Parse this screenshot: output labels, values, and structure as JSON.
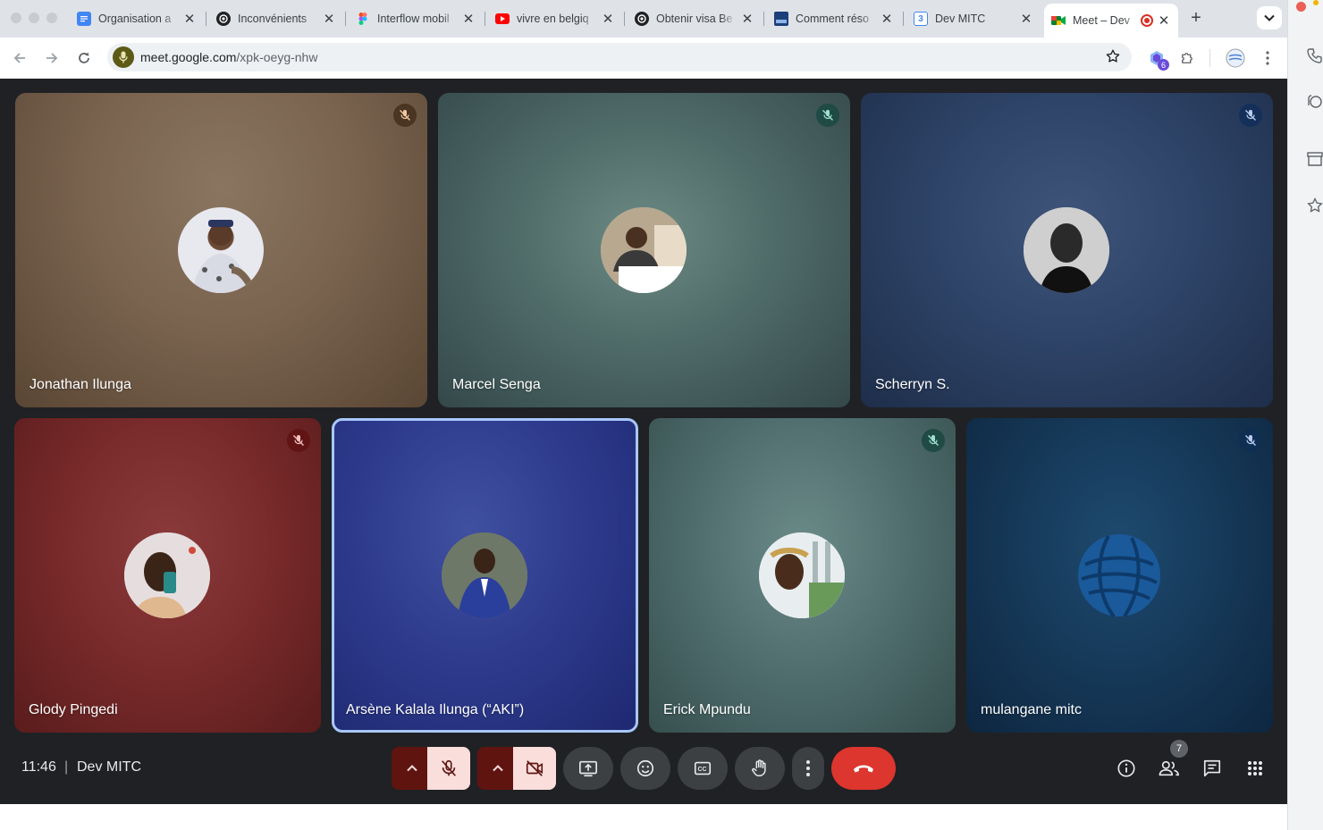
{
  "browser": {
    "tabs": [
      {
        "title": "Organisation a",
        "favicon": "google-docs-icon"
      },
      {
        "title": "Inconvénients",
        "favicon": "openai-icon"
      },
      {
        "title": "Interflow mobil",
        "favicon": "figma-icon"
      },
      {
        "title": "vivre en belgiq",
        "favicon": "youtube-icon"
      },
      {
        "title": "Obtenir visa Be",
        "favicon": "openai-icon"
      },
      {
        "title": "Comment réso",
        "favicon": "site-icon"
      },
      {
        "title": "Dev MITC",
        "favicon": "google-calendar-icon"
      },
      {
        "title": "Meet – Dev",
        "favicon": "google-meet-icon"
      }
    ],
    "calendar_favicon_text": "3",
    "url_host": "meet.google.com",
    "url_path": "/xpk-oeyg-nhw",
    "extension_badge": "6"
  },
  "meeting": {
    "time": "11:46",
    "separator": "|",
    "name": "Dev MITC",
    "participant_count": "7"
  },
  "participants": [
    {
      "name": "Jonathan Ilunga",
      "muted": true,
      "color": "#7a6450"
    },
    {
      "name": "Marcel Senga",
      "muted": true,
      "color": "#4f6b68"
    },
    {
      "name": "Scherryn S.",
      "muted": true,
      "color": "#2e4468"
    },
    {
      "name": "Glody Pingedi",
      "muted": true,
      "color": "#7a2b2b"
    },
    {
      "name": "Arsène Kalala Ilunga (“AKI”)",
      "muted": false,
      "speaking": true,
      "color": "#2d3a8c"
    },
    {
      "name": "Erick Mpundu",
      "muted": true,
      "color": "#527070"
    },
    {
      "name": "mulangane mitc",
      "muted": true,
      "color": "#163a5a"
    }
  ],
  "controls": {
    "mic": "mic-off-icon",
    "camera": "camera-off-icon",
    "present": "present-screen-icon",
    "reactions": "emoji-icon",
    "captions": "captions-icon",
    "raise_hand": "hand-icon",
    "more": "more-options-icon",
    "end_call": "end-call-icon",
    "info": "info-icon",
    "people": "people-icon",
    "chat": "chat-icon",
    "activities": "apps-grid-icon"
  },
  "colors": {
    "meet_bg": "#202124",
    "end_call": "#dc362e",
    "control_bg": "#3c4043",
    "muted_pill": "#601410",
    "muted_pill_light": "#f9dedc",
    "speaking_border": "#a8c7fa"
  }
}
